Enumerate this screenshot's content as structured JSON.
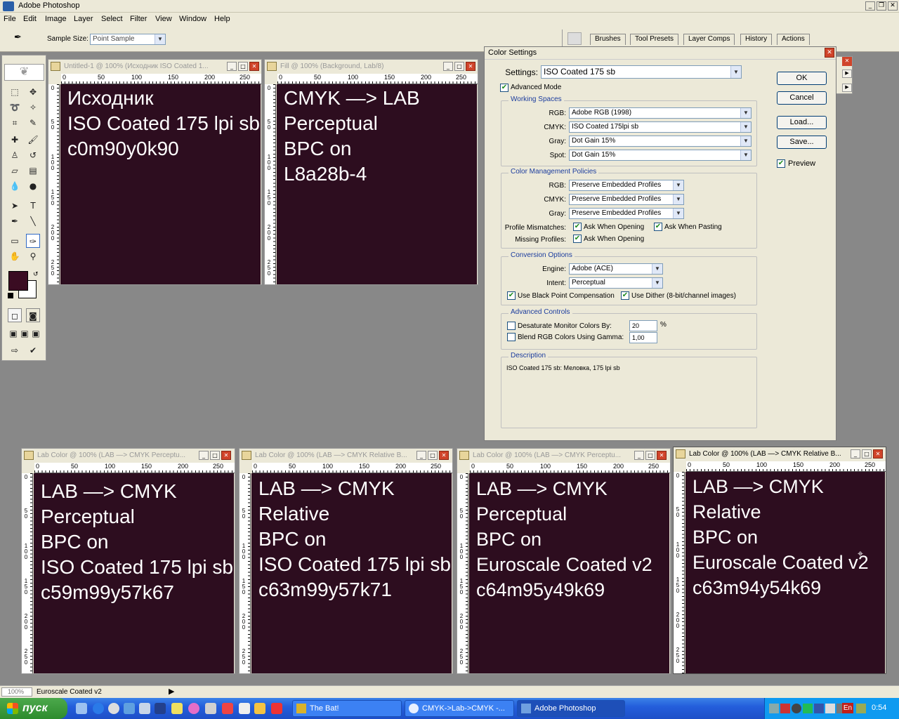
{
  "app": {
    "title": "Adobe Photoshop"
  },
  "menu": [
    "File",
    "Edit",
    "Image",
    "Layer",
    "Select",
    "Filter",
    "View",
    "Window",
    "Help"
  ],
  "options_bar": {
    "sample_size_label": "Sample Size:",
    "sample_size_value": "Point Sample"
  },
  "palette_tabs": [
    "Brushes",
    "Tool Presets",
    "Layer Comps",
    "History",
    "Actions"
  ],
  "documents_top": [
    {
      "title": "Untitled-1 @ 100% (Исходник ISO Coated 1...",
      "lines": [
        "Исходник",
        "ISO Coated 175 lpi sb",
        "c0m90y0k90"
      ]
    },
    {
      "title": "Fill @ 100% (Background, Lab/8)",
      "lines": [
        "CMYK —> LAB",
        "Perceptual",
        "BPC on",
        "L8a28b-4"
      ]
    }
  ],
  "documents_bottom": [
    {
      "title": "Lab Color @ 100% (LAB —> CMYK Perceptu...",
      "lines": [
        "LAB —> CMYK",
        "Perceptual",
        "BPC on",
        "ISO Coated 175 lpi sb",
        "c59m99y57k67"
      ]
    },
    {
      "title": "Lab Color @ 100% (LAB —> CMYK Relative B...",
      "lines": [
        "LAB —> CMYK",
        "Relative",
        "BPC on",
        "ISO Coated 175 lpi sb",
        "c63m99y57k71"
      ]
    },
    {
      "title": "Lab Color @ 100% (LAB —> CMYK Perceptu...",
      "lines": [
        "LAB —> CMYK",
        "Perceptual",
        "BPC on",
        "Euroscale Coated v2",
        "c64m95y49k69"
      ]
    },
    {
      "title": "Lab Color @ 100% (LAB —> CMYK Relative B...",
      "lines": [
        "LAB —> CMYK",
        "Relative",
        "BPC on",
        "Euroscale Coated v2",
        "c63m94y54k69"
      ]
    }
  ],
  "ruler_h": [
    "0",
    "50",
    "100",
    "150",
    "200",
    "250"
  ],
  "ruler_v_top": [
    "0",
    "5\n0",
    "1\n0\n0",
    "1\n5\n0",
    "2\n0\n0",
    "2\n5\n0"
  ],
  "dialog": {
    "title": "Color Settings",
    "settings_label": "Settings:",
    "settings_value": "ISO Coated 175 sb",
    "advanced_mode": "Advanced Mode",
    "working_spaces": {
      "label": "Working Spaces",
      "rgb_label": "RGB:",
      "rgb": "Adobe RGB (1998)",
      "cmyk_label": "CMYK:",
      "cmyk": "ISO Coated 175lpi sb",
      "gray_label": "Gray:",
      "gray": "Dot Gain 15%",
      "spot_label": "Spot:",
      "spot": "Dot Gain 15%"
    },
    "policies": {
      "label": "Color Management Policies",
      "rgb_label": "RGB:",
      "rgb": "Preserve Embedded Profiles",
      "cmyk_label": "CMYK:",
      "cmyk": "Preserve Embedded Profiles",
      "gray_label": "Gray:",
      "gray": "Preserve Embedded Profiles",
      "mismatch_label": "Profile Mismatches:",
      "ask_opening": "Ask When Opening",
      "ask_pasting": "Ask When Pasting",
      "missing_label": "Missing Profiles:",
      "ask_opening2": "Ask When Opening"
    },
    "conversion": {
      "label": "Conversion Options",
      "engine_label": "Engine:",
      "engine": "Adobe (ACE)",
      "intent_label": "Intent:",
      "intent": "Perceptual",
      "bpc": "Use Black Point Compensation",
      "dither": "Use Dither (8-bit/channel images)"
    },
    "advanced": {
      "label": "Advanced Controls",
      "desaturate": "Desaturate Monitor Colors By:",
      "desaturate_value": "20",
      "percent": "%",
      "blend": "Blend RGB Colors Using Gamma:",
      "blend_value": "1,00"
    },
    "description": {
      "label": "Description",
      "text": "ISO Coated 175 sb:  Меловка, 175 lpi sb"
    },
    "buttons": {
      "ok": "OK",
      "cancel": "Cancel",
      "load": "Load...",
      "save": "Save...",
      "preview": "Preview"
    }
  },
  "statusbar": {
    "zoom": "100%",
    "info": "Euroscale Coated v2"
  },
  "taskbar": {
    "start": "пуск",
    "tasks": [
      "The Bat!",
      "CMYK->Lab->CMYK -...",
      "Adobe Photoshop"
    ],
    "tray_lang": "En",
    "clock": "0:54"
  },
  "colors": {
    "canvas": "#2d0d1f",
    "foreground": "#3a0c22",
    "taskbar": "#245edc"
  }
}
